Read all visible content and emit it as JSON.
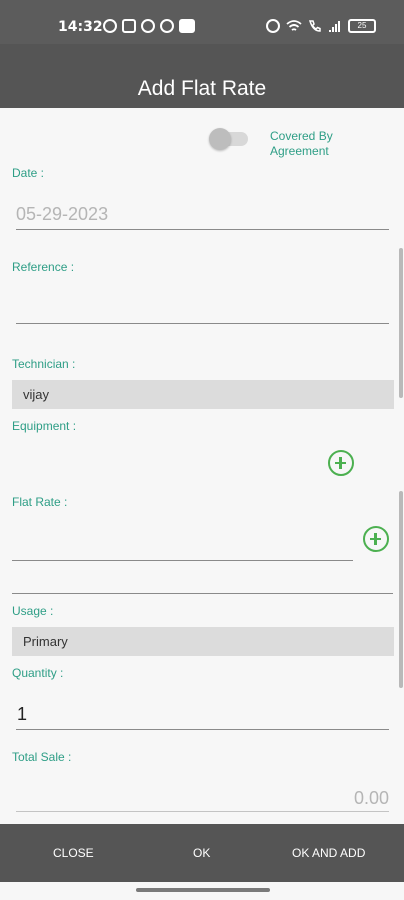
{
  "status_bar": {
    "time": "14:32",
    "battery": "25"
  },
  "header": {
    "title": "Add Flat Rate"
  },
  "form": {
    "covered_by_agreement": {
      "label": "Covered By Agreement",
      "on": false
    },
    "date": {
      "label": "Date :",
      "value": "05-29-2023"
    },
    "reference": {
      "label": "Reference :",
      "value": ""
    },
    "technician": {
      "label": "Technician :",
      "value": "vijay"
    },
    "equipment": {
      "label": "Equipment :"
    },
    "flat_rate": {
      "label": "Flat Rate :",
      "value": ""
    },
    "usage": {
      "label": "Usage :",
      "value": "Primary"
    },
    "quantity": {
      "label": "Quantity :",
      "value": "1"
    },
    "total_sale": {
      "label": "Total Sale :",
      "value": "0.00"
    }
  },
  "footer": {
    "close_label": "CLOSE",
    "ok_label": "OK",
    "ok_and_add_label": "OK AND ADD"
  },
  "colors": {
    "accent_teal": "#2e9e86",
    "add_green": "#4cb050",
    "bar_gray": "#555555"
  },
  "icons": [
    "whatsapp-icon",
    "instagram-icon",
    "messenger-icon",
    "missed-call-icon",
    "message-icon",
    "alarm-icon",
    "wifi-icon",
    "call-icon",
    "signal-icon",
    "battery-icon",
    "add-circle-icon"
  ]
}
